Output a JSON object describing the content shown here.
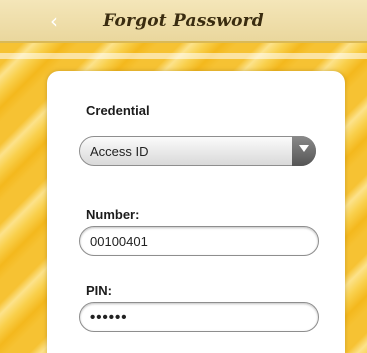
{
  "header": {
    "back_icon": "‹",
    "title": "Forgot Password"
  },
  "form": {
    "credential": {
      "label": "Credential",
      "selected": "Access ID"
    },
    "number": {
      "label": "Number:",
      "value": "00100401"
    },
    "pin": {
      "label": "PIN:",
      "value": "••••••"
    }
  },
  "colors": {
    "header_bg": "#ead79d",
    "background_yellow": "#f6c233",
    "title_text": "#3a2c10"
  }
}
